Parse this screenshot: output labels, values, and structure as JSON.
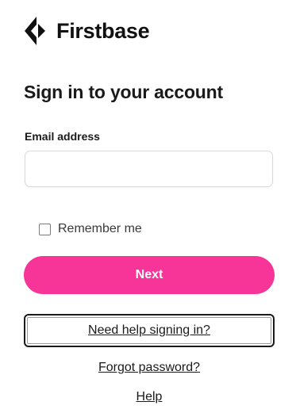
{
  "brand": {
    "name": "Firstbase",
    "logo_icon": "firstbase-diamond-logo-icon"
  },
  "signin": {
    "title": "Sign in to your account",
    "email_label": "Email address",
    "email_value": "",
    "email_placeholder": "",
    "remember_label": "Remember me",
    "remember_checked": false,
    "next_label": "Next",
    "help_signing_in_label": "Need help signing in?",
    "forgot_password_label": "Forgot password?",
    "help_label": "Help"
  },
  "colors": {
    "accent": "#f73497",
    "text": "#1a1a1a",
    "input_border": "#d9d9d9"
  }
}
